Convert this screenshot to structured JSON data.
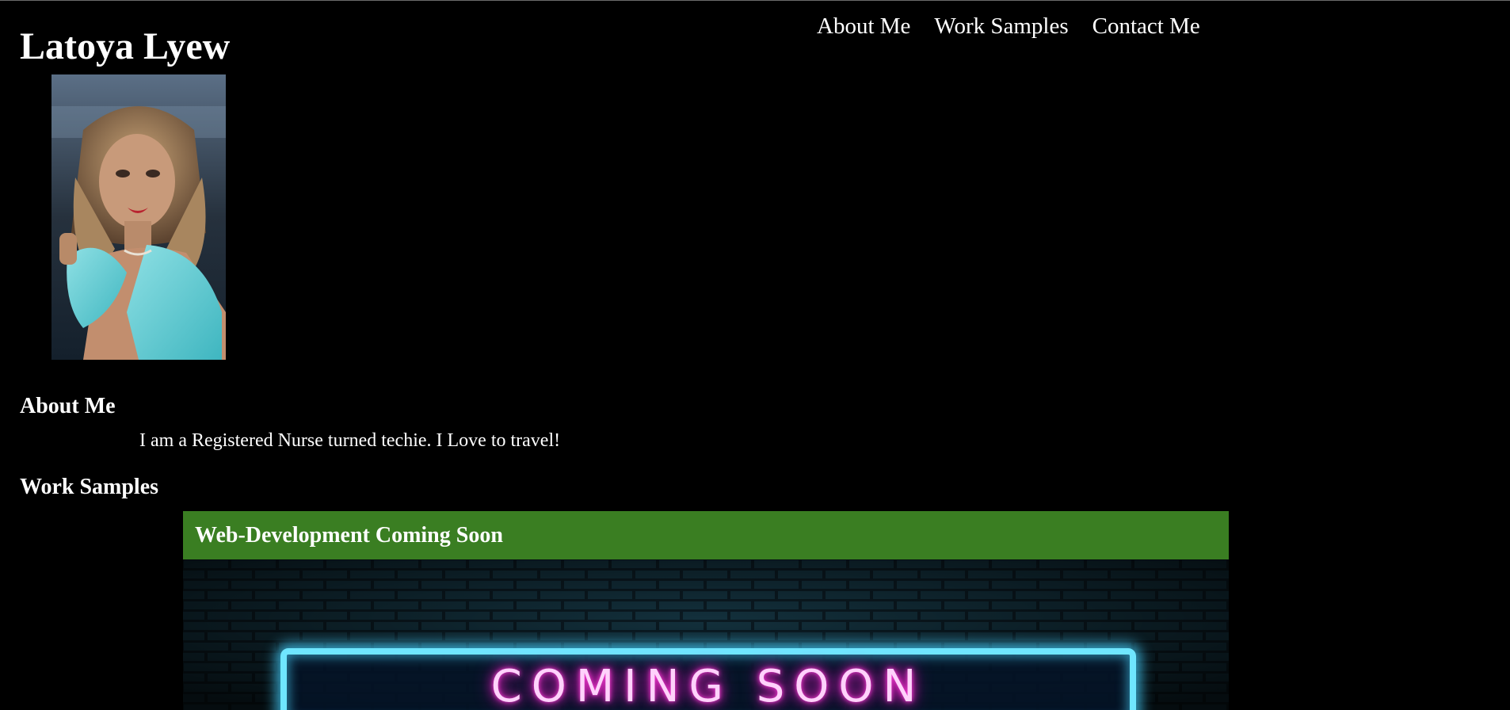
{
  "header": {
    "site_name": "Latoya Lyew"
  },
  "nav": {
    "items": [
      {
        "label": "About Me"
      },
      {
        "label": "Work Samples"
      },
      {
        "label": "Contact Me"
      }
    ]
  },
  "about": {
    "heading": "About Me",
    "text": "I am a Registered Nurse turned techie. I Love to travel!"
  },
  "work": {
    "heading": "Work Samples",
    "samples": [
      {
        "title": "Web-Development Coming Soon",
        "image_text": "COMING SOON"
      }
    ]
  },
  "colors": {
    "background": "#000000",
    "text": "#ffffff",
    "sample_banner": "#3a7e22",
    "neon_frame": "#6fe6ff",
    "neon_text": "#ff3fd9"
  }
}
